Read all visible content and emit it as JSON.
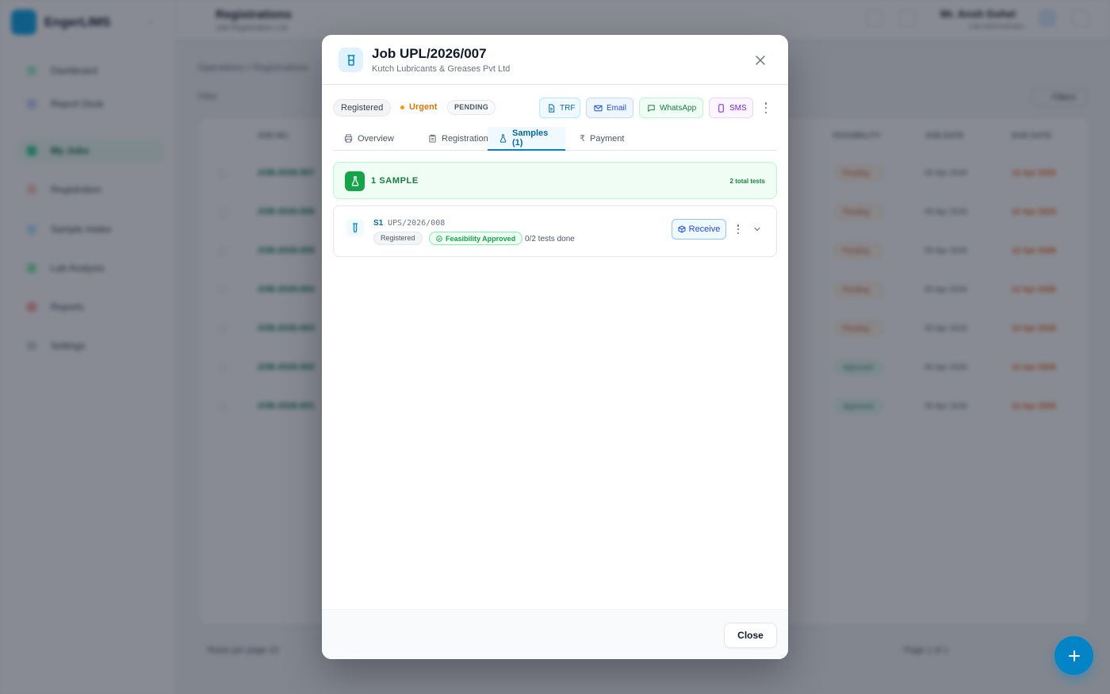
{
  "background": {
    "brand": "EngerLIMS",
    "nav": [
      "Dashboard",
      "Report Desk",
      "My Jobs",
      "Registration",
      "Sample Intake",
      "Lab Analysis",
      "Reports",
      "Settings"
    ],
    "page_title": "Registrations",
    "page_subtitle": "Job Registration List",
    "user_name": "Mr. Ansh Gohel",
    "user_role": "Lab Administrator",
    "breadcrumb": "Operations  /  Registrations",
    "filter_label": "Filter",
    "filters_button": "Filters",
    "columns": [
      "JOB NO.",
      "FEASIBILITY",
      "JOB DATE",
      "DUE DATE"
    ],
    "rows": [
      {
        "id": "JOB-2026-007",
        "status": "Pending",
        "status_color": "orange",
        "date": "05 Apr 2026",
        "due": "12 Apr 2026"
      },
      {
        "id": "JOB-2026-006",
        "status": "Pending",
        "status_color": "orange",
        "date": "05 Apr 2026",
        "due": "12 Apr 2026"
      },
      {
        "id": "JOB-2026-005",
        "status": "Pending",
        "status_color": "orange",
        "date": "05 Apr 2026",
        "due": "12 Apr 2026"
      },
      {
        "id": "JOB-2026-004",
        "status": "Pending",
        "status_color": "orange",
        "date": "05 Apr 2026",
        "due": "12 Apr 2026"
      },
      {
        "id": "JOB-2026-003",
        "status": "Pending",
        "status_color": "orange",
        "date": "05 Apr 2026",
        "due": "12 Apr 2026"
      },
      {
        "id": "JOB-2026-002",
        "status": "Approved",
        "status_color": "green",
        "date": "05 Apr 2026",
        "due": "12 Apr 2026"
      },
      {
        "id": "JOB-2026-001",
        "status": "Approved",
        "status_color": "green",
        "date": "05 Apr 2026",
        "due": "12 Apr 2026"
      }
    ],
    "rows_per_page": "Rows per page  10",
    "pagination": "Page  1  of 1"
  },
  "modal": {
    "title": "Job UPL/2026/007",
    "client": "Kutch Lubricants & Greases Pvt Ltd",
    "status": {
      "registered": "Registered",
      "priority": "Urgent",
      "stage": "PENDING"
    },
    "actions": {
      "trf": "TRF",
      "email": "Email",
      "whatsapp": "WhatsApp",
      "sms": "SMS"
    },
    "tabs": [
      {
        "label": "Overview",
        "icon": "printer-icon"
      },
      {
        "label": "Registration",
        "icon": "clipboard-icon"
      },
      {
        "label": "Samples (1)",
        "icon": "flask-icon",
        "active": true
      },
      {
        "label": "Payment",
        "icon": "rupee-icon"
      }
    ],
    "summary": {
      "count_label": "1 SAMPLE",
      "tests_label": "2 total tests"
    },
    "sample": {
      "number": "S1",
      "code": "UPS/2026/008",
      "status": "Registered",
      "feasibility": "Feasibility Approved",
      "progress": "0/2 tests done",
      "receive_label": "Receive"
    },
    "footer": {
      "close_label": "Close"
    }
  },
  "colors": {
    "accent": "#0284c7",
    "success": "#16a34a",
    "warning": "#d97706"
  }
}
